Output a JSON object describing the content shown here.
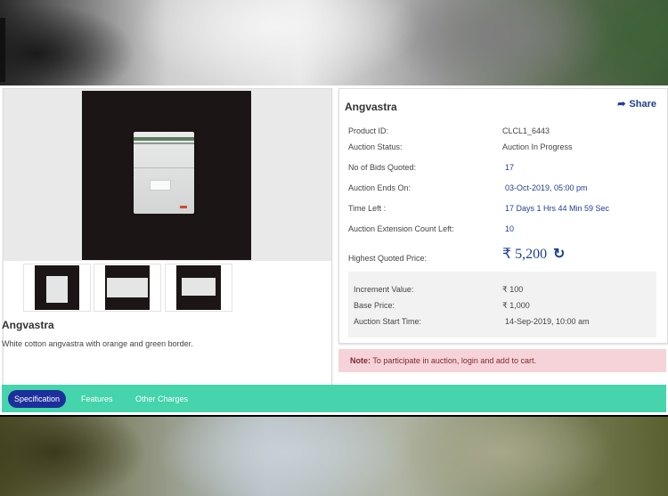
{
  "product": {
    "title": "Angvastra",
    "description": "White cotton angvastra with orange and green border."
  },
  "info": {
    "title": "Angvastra",
    "share_label": "Share",
    "rows": [
      {
        "label": "Product ID:",
        "value": "CLCL1_6443"
      },
      {
        "label": "Auction Status:",
        "value": "Auction In Progress"
      },
      {
        "label": "No of Bids Quoted:",
        "value": "17"
      },
      {
        "label": "Auction Ends On:",
        "value": "03-Oct-2019, 05:00 pm"
      },
      {
        "label": "Time Left :",
        "value": "17 Days 1 Hrs 44 Min 59 Sec"
      },
      {
        "label": "Auction Extension Count Left:",
        "value": "10"
      }
    ],
    "highest_price_label": "Highest Quoted Price:",
    "highest_price": "₹ 5,200",
    "details": [
      {
        "label": "Increment Value:",
        "value": "₹ 100"
      },
      {
        "label": "Base Price:",
        "value": "₹ 1,000"
      },
      {
        "label": "Auction Start Time:",
        "value": "14-Sep-2019, 10:00 am"
      }
    ]
  },
  "note": {
    "prefix": "Note:",
    "text": " To participate in auction, login and add to cart."
  },
  "tabs": [
    {
      "label": "Specification",
      "active": true
    },
    {
      "label": "Features",
      "active": false
    },
    {
      "label": "Other Charges",
      "active": false
    }
  ],
  "icons": {
    "share": "share-icon",
    "refresh": "refresh-icon"
  },
  "colors": {
    "accent_blue": "#1f3f95",
    "tab_bar": "#45d4ac",
    "active_tab": "#1d2f9a",
    "note_bg": "#f6d3d8"
  }
}
